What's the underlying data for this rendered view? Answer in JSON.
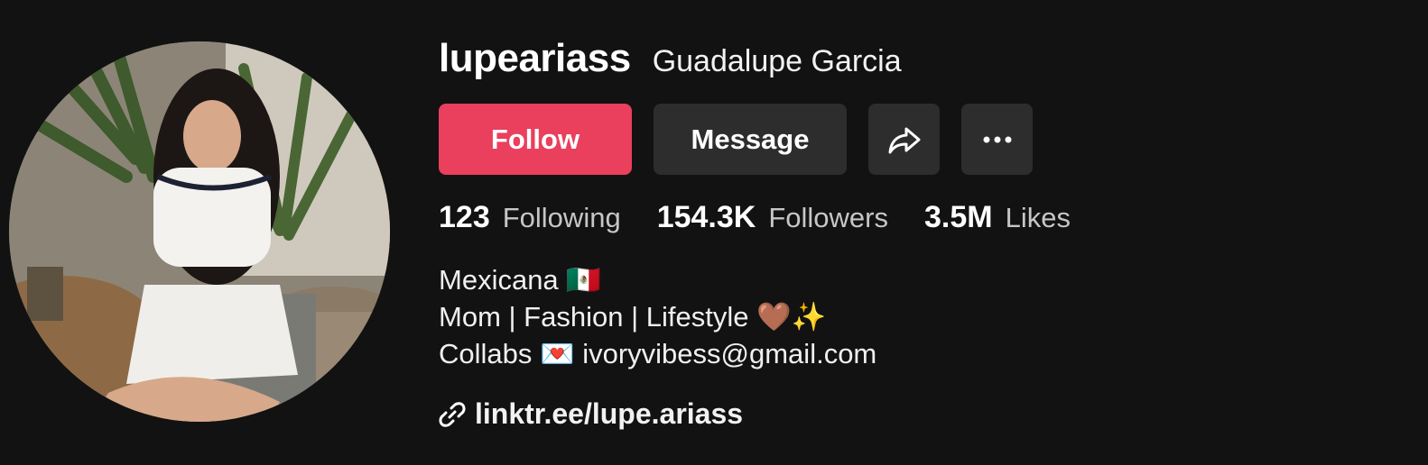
{
  "profile": {
    "username": "lupeariass",
    "display_name": "Guadalupe Garcia"
  },
  "actions": {
    "follow_label": "Follow",
    "message_label": "Message",
    "share_icon": "share-icon",
    "more_icon": "more-icon"
  },
  "stats": [
    {
      "value": "123",
      "label": "Following"
    },
    {
      "value": "154.3K",
      "label": "Followers"
    },
    {
      "value": "3.5M",
      "label": "Likes"
    }
  ],
  "bio": [
    "Mexicana 🇲🇽",
    "Mom | Fashion | Lifestyle 🤎✨",
    "Collabs 💌 ivoryvibess@gmail.com"
  ],
  "link": {
    "icon": "link-icon",
    "text": "linktr.ee/lupe.ariass"
  },
  "colors": {
    "background": "#121212",
    "follow_button": "#ea3f5d",
    "secondary_button": "#2d2d2d"
  }
}
